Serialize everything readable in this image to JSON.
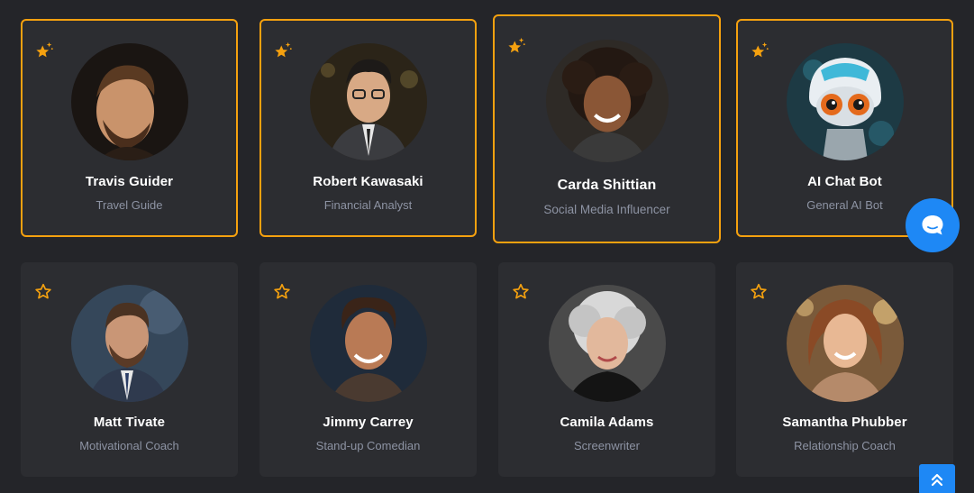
{
  "colors": {
    "accent": "#f5a10f",
    "card_bg": "#2c2d31",
    "page_bg": "#242529",
    "button_blue": "#1e88f5"
  },
  "cards": [
    {
      "name": "Travis Guider",
      "role": "Travel Guide",
      "favorite": true,
      "avatar": "bearded-man-portrait"
    },
    {
      "name": "Robert Kawasaki",
      "role": "Financial Analyst",
      "favorite": true,
      "avatar": "man-glasses-suit-portrait"
    },
    {
      "name": "Carda Shittian",
      "role": "Social Media Influencer",
      "favorite": true,
      "avatar": "curly-hair-woman-portrait"
    },
    {
      "name": "AI Chat Bot",
      "role": "General AI Bot",
      "favorite": true,
      "avatar": "robot-portrait"
    },
    {
      "name": "Matt Tivate",
      "role": "Motivational Coach",
      "favorite": false,
      "avatar": "man-tie-portrait"
    },
    {
      "name": "Jimmy Carrey",
      "role": "Stand-up Comedian",
      "favorite": false,
      "avatar": "smiling-man-portrait"
    },
    {
      "name": "Camila Adams",
      "role": "Screenwriter",
      "favorite": false,
      "avatar": "silver-hair-woman-portrait"
    },
    {
      "name": "Samantha Phubber",
      "role": "Relationship Coach",
      "favorite": false,
      "avatar": "wavy-hair-woman-portrait"
    }
  ],
  "icons": {
    "favorite": "star-sparkle-icon",
    "not_favorite": "star-outline-icon",
    "chat": "chat-bubble-icon",
    "scroll_top": "double-chevron-up-icon"
  }
}
